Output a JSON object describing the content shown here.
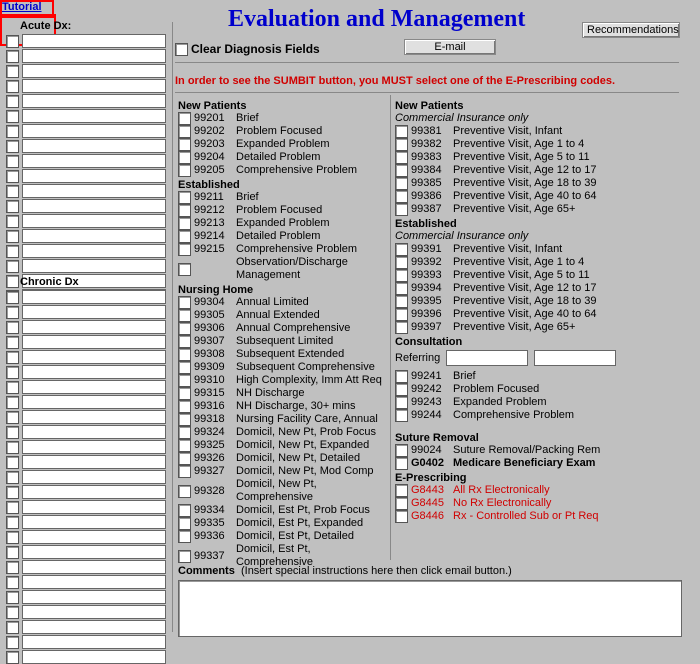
{
  "tutorial_label": "Tutorial",
  "title": "Evaluation and Management",
  "recommendations_btn": "Recommendations",
  "email_btn": "E-mail",
  "clear_dx_label": "Clear Diagnosis Fields",
  "warning": "In order to see the SUMBIT button, you MUST select one of the E-Prescribing codes.",
  "acute_dx": {
    "title": "Acute Dx:",
    "rows": 18
  },
  "chronic_dx": {
    "title": "Chronic Dx",
    "rows": 25
  },
  "left": {
    "new_patients_hd": "New Patients",
    "new_patients": [
      {
        "code": "99201",
        "desc": "Brief"
      },
      {
        "code": "99202",
        "desc": "Problem Focused"
      },
      {
        "code": "99203",
        "desc": "Expanded Problem"
      },
      {
        "code": "99204",
        "desc": "Detailed Problem"
      },
      {
        "code": "99205",
        "desc": "Comprehensive Problem"
      }
    ],
    "established_hd": "Established",
    "established": [
      {
        "code": "99211",
        "desc": "Brief"
      },
      {
        "code": "99212",
        "desc": "Problem Focused"
      },
      {
        "code": "99213",
        "desc": "Expanded Problem"
      },
      {
        "code": "99214",
        "desc": "Detailed Problem"
      },
      {
        "code": "99215",
        "desc": "Comprehensive Problem"
      },
      {
        "code": "",
        "desc": "Observation/Discharge Management"
      }
    ],
    "nursing_hd": "Nursing Home",
    "nursing": [
      {
        "code": "99304",
        "desc": "Annual Limited"
      },
      {
        "code": "99305",
        "desc": "Annual Extended"
      },
      {
        "code": "99306",
        "desc": "Annual Comprehensive"
      },
      {
        "code": "99307",
        "desc": "Subsequent Limited"
      },
      {
        "code": "99308",
        "desc": "Subsequent Extended"
      },
      {
        "code": "99309",
        "desc": "Subsequent Comprehensive"
      },
      {
        "code": "99310",
        "desc": "High Complexity, Imm Att Req"
      },
      {
        "code": "99315",
        "desc": "NH Discharge"
      },
      {
        "code": "99316",
        "desc": "NH Discharge, 30+ mins"
      },
      {
        "code": "99318",
        "desc": "Nursing Facility Care, Annual"
      },
      {
        "code": "99324",
        "desc": "Domicil, New Pt, Prob Focus"
      },
      {
        "code": "99325",
        "desc": "Domicil, New Pt, Expanded"
      },
      {
        "code": "99326",
        "desc": "Domicil, New Pt, Detailed"
      },
      {
        "code": "99327",
        "desc": "Domicil, New Pt, Mod Comp"
      },
      {
        "code": "99328",
        "desc": "Domicil, New Pt, Comprehensive"
      },
      {
        "code": "99334",
        "desc": "Domicil, Est Pt, Prob Focus"
      },
      {
        "code": "99335",
        "desc": "Domicil, Est Pt, Expanded"
      },
      {
        "code": "99336",
        "desc": "Domicil, Est Pt, Detailed"
      },
      {
        "code": "99337",
        "desc": "Domicil, Est Pt, Comprehensive"
      }
    ]
  },
  "right": {
    "new_patients_hd": "New Patients",
    "new_sub": "Commercial Insurance only",
    "new_patients": [
      {
        "code": "99381",
        "desc": "Preventive Visit, Infant"
      },
      {
        "code": "99382",
        "desc": "Preventive Visit, Age 1 to 4"
      },
      {
        "code": "99383",
        "desc": "Preventive Visit, Age 5 to 11"
      },
      {
        "code": "99384",
        "desc": "Preventive Visit, Age 12 to 17"
      },
      {
        "code": "99385",
        "desc": "Preventive Visit, Age 18 to 39"
      },
      {
        "code": "99386",
        "desc": "Preventive Visit, Age 40 to 64"
      },
      {
        "code": "99387",
        "desc": "Preventive Visit, Age 65+"
      }
    ],
    "established_hd": "Established",
    "est_sub": "Commercial Insurance only",
    "established": [
      {
        "code": "99391",
        "desc": "Preventive Visit, Infant"
      },
      {
        "code": "99392",
        "desc": "Preventive Visit, Age 1 to 4"
      },
      {
        "code": "99393",
        "desc": "Preventive Visit, Age 5 to 11"
      },
      {
        "code": "99394",
        "desc": "Preventive Visit, Age 12 to 17"
      },
      {
        "code": "99395",
        "desc": "Preventive Visit, Age 18 to 39"
      },
      {
        "code": "99396",
        "desc": "Preventive Visit, Age 40 to 64"
      },
      {
        "code": "99397",
        "desc": "Preventive Visit, Age 65+"
      }
    ],
    "consult_hd": "Consultation",
    "referring_label": "Referring",
    "consult": [
      {
        "code": "99241",
        "desc": "Brief"
      },
      {
        "code": "99242",
        "desc": "Problem Focused"
      },
      {
        "code": "99243",
        "desc": "Expanded Problem"
      },
      {
        "code": "99244",
        "desc": "Comprehensive Problem"
      }
    ],
    "suture_hd": "Suture Removal",
    "suture": [
      {
        "code": "99024",
        "desc": "Suture Removal/Packing Rem"
      }
    ],
    "medicare": {
      "code": "G0402",
      "desc": "Medicare Beneficiary Exam"
    },
    "eprescribe_hd": "E-Prescribing",
    "eprescribe": [
      {
        "code": "G8443",
        "desc": "All Rx Electronically"
      },
      {
        "code": "G8445",
        "desc": "No Rx Electronically"
      },
      {
        "code": "G8446",
        "desc": "Rx - Controlled Sub or Pt Req"
      }
    ]
  },
  "comments": {
    "label": "Comments",
    "hint": "(Insert special instructions here then click email button.)"
  }
}
